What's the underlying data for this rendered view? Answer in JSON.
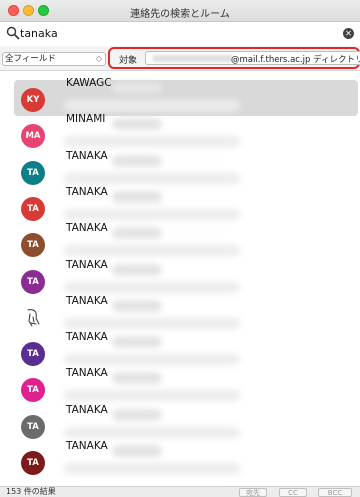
{
  "window": {
    "title": "連絡先の検索とルーム"
  },
  "search": {
    "query": "tanaka"
  },
  "filter": {
    "field_select": "全フィールド",
    "scope_label": "対象",
    "scope_value": "@mail.f.thers.ac.jp ディレクトリ"
  },
  "contacts": [
    {
      "initials": "KY",
      "name": "KAWAGC",
      "color": "#d83a35",
      "selected": true
    },
    {
      "initials": "MA",
      "name": "MINAMI",
      "color": "#e54570"
    },
    {
      "initials": "TA",
      "name": "TANAKA",
      "color": "#0e7f86"
    },
    {
      "initials": "TA",
      "name": "TANAKA",
      "color": "#d83a35"
    },
    {
      "initials": "TA",
      "name": "TANAKA",
      "color": "#8c4e2c"
    },
    {
      "initials": "TA",
      "name": "TANAKA",
      "color": "#8b2c92"
    },
    {
      "initials": "",
      "name": "TANAKA",
      "color": "#ffffff",
      "icon": "sketch-avatar-icon"
    },
    {
      "initials": "TA",
      "name": "TANAKA",
      "color": "#5a2d91"
    },
    {
      "initials": "TA",
      "name": "TANAKA",
      "color": "#e0208f"
    },
    {
      "initials": "TA",
      "name": "TANAKA",
      "color": "#6b6b6b"
    },
    {
      "initials": "TA",
      "name": "TANAKA",
      "color": "#7d1a1a"
    }
  ],
  "status": {
    "result_count": "153 件の結果",
    "to_label": "宛先",
    "cc_label": "CC",
    "bcc_label": "BCC"
  }
}
